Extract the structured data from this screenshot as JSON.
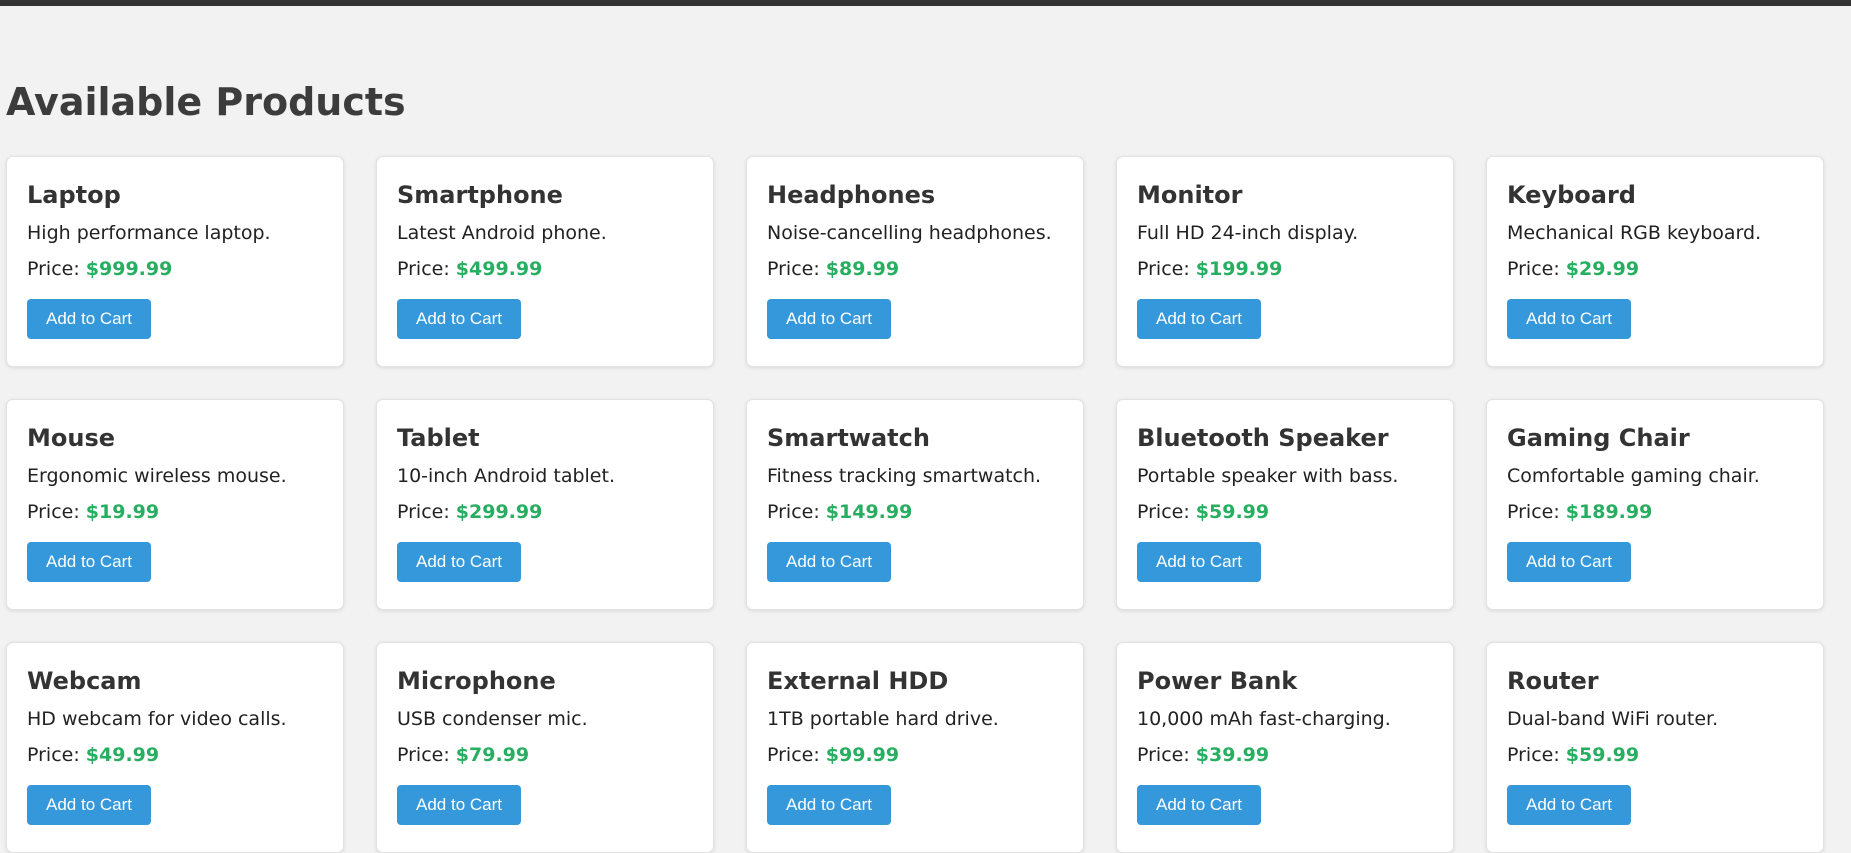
{
  "page": {
    "title": "Available Products"
  },
  "colors": {
    "topbar": "#333333",
    "price": "#27ae60",
    "button": "#3498db"
  },
  "price_label": "Price: ",
  "products": [
    {
      "name": "Laptop",
      "description": "High performance laptop.",
      "price": "$999.99",
      "button": "Add to Cart"
    },
    {
      "name": "Smartphone",
      "description": "Latest Android phone.",
      "price": "$499.99",
      "button": "Add to Cart"
    },
    {
      "name": "Headphones",
      "description": "Noise-cancelling headphones.",
      "price": "$89.99",
      "button": "Add to Cart"
    },
    {
      "name": "Monitor",
      "description": "Full HD 24-inch display.",
      "price": "$199.99",
      "button": "Add to Cart"
    },
    {
      "name": "Keyboard",
      "description": "Mechanical RGB keyboard.",
      "price": "$29.99",
      "button": "Add to Cart"
    },
    {
      "name": "Mouse",
      "description": "Ergonomic wireless mouse.",
      "price": "$19.99",
      "button": "Add to Cart"
    },
    {
      "name": "Tablet",
      "description": "10-inch Android tablet.",
      "price": "$299.99",
      "button": "Add to Cart"
    },
    {
      "name": "Smartwatch",
      "description": "Fitness tracking smartwatch.",
      "price": "$149.99",
      "button": "Add to Cart"
    },
    {
      "name": "Bluetooth Speaker",
      "description": "Portable speaker with bass.",
      "price": "$59.99",
      "button": "Add to Cart"
    },
    {
      "name": "Gaming Chair",
      "description": "Comfortable gaming chair.",
      "price": "$189.99",
      "button": "Add to Cart"
    },
    {
      "name": "Webcam",
      "description": "HD webcam for video calls.",
      "price": "$49.99",
      "button": "Add to Cart"
    },
    {
      "name": "Microphone",
      "description": "USB condenser mic.",
      "price": "$79.99",
      "button": "Add to Cart"
    },
    {
      "name": "External HDD",
      "description": "1TB portable hard drive.",
      "price": "$99.99",
      "button": "Add to Cart"
    },
    {
      "name": "Power Bank",
      "description": "10,000 mAh fast-charging.",
      "price": "$39.99",
      "button": "Add to Cart"
    },
    {
      "name": "Router",
      "description": "Dual-band WiFi router.",
      "price": "$59.99",
      "button": "Add to Cart"
    }
  ]
}
